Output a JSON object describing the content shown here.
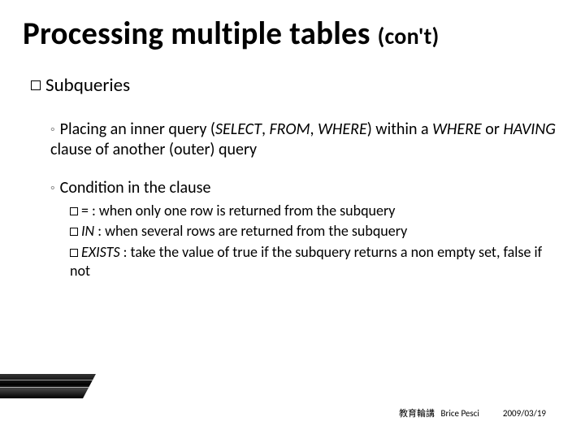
{
  "title": {
    "main": "Processing multiple tables",
    "suffix": "(con't)"
  },
  "lvl1": {
    "heading": "Subqueries"
  },
  "lvl2": {
    "definition_a": "Placing an inner query (",
    "kw1": "SELECT",
    "sep1": ", ",
    "kw2": "FROM",
    "sep2": ", ",
    "kw3": "WHERE",
    "definition_b": ") within a ",
    "kw4": "WHERE",
    "definition_c": " or ",
    "kw5": "HAVING",
    "definition_d": " clause of another (outer) query",
    "condition_heading": "Condition in the clause"
  },
  "lvl3": {
    "eq_sym": "=",
    "eq_text": " : when only one row is returned from the subquery",
    "in_kw": "IN",
    "in_text": " : when several rows are returned from the subquery",
    "ex_kw": "EXISTS",
    "ex_text": " : take the value of true if the subquery returns a non empty set, false if not"
  },
  "footer": {
    "label": "教育輪講",
    "author": "Brice Pesci",
    "date": "2009/03/19"
  }
}
